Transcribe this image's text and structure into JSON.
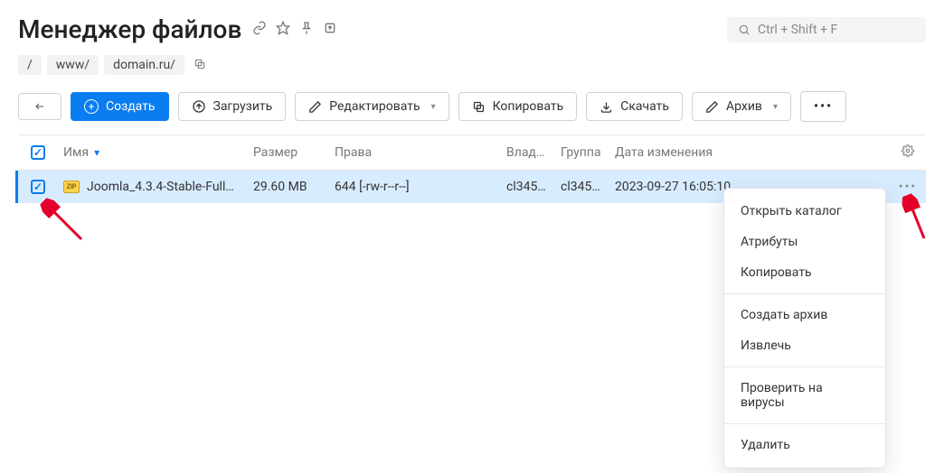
{
  "header": {
    "title": "Менеджер файлов",
    "search_placeholder": "Ctrl + Shift + F"
  },
  "breadcrumb": {
    "root": "/",
    "seg1": "www/",
    "seg2": "domain.ru/"
  },
  "toolbar": {
    "create": "Создать",
    "upload": "Загрузить",
    "edit": "Редактировать",
    "copy": "Копировать",
    "download": "Скачать",
    "archive": "Архив"
  },
  "columns": {
    "name": "Имя",
    "size": "Размер",
    "perm": "Права",
    "owner": "Влад…",
    "group": "Группа",
    "mtime": "Дата изменения"
  },
  "rows": [
    {
      "name": "Joomla_4.3.4-Stable-Full…",
      "size": "29.60 MB",
      "perm": "644 [-rw-r--r--]",
      "owner": "cl345…",
      "group": "cl345…",
      "mtime": "2023-09-27 16:05:10"
    }
  ],
  "menu": {
    "open": "Открыть каталог",
    "attrs": "Атрибуты",
    "copy": "Копировать",
    "mkarchive": "Создать архив",
    "extract": "Извлечь",
    "scan": "Проверить на вирусы",
    "delete": "Удалить"
  }
}
